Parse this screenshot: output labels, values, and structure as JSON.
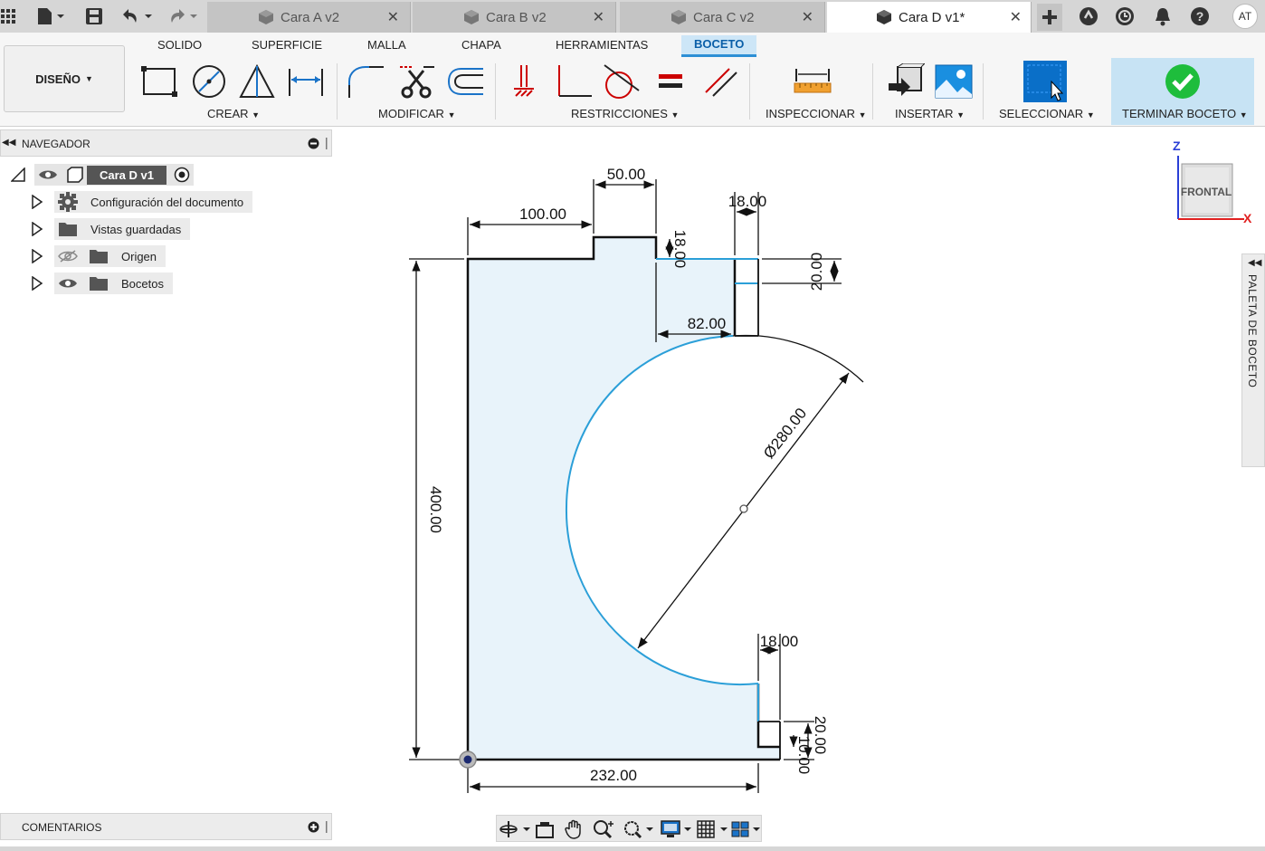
{
  "tabs": [
    {
      "label": "Cara A v2",
      "active": false
    },
    {
      "label": "Cara B v2",
      "active": false
    },
    {
      "label": "Cara C v2",
      "active": false
    },
    {
      "label": "Cara D v1*",
      "active": true
    }
  ],
  "user_initials": "AT",
  "workspace": "DISEÑO",
  "ribbon_tabs": [
    "SOLIDO",
    "SUPERFICIE",
    "MALLA",
    "CHAPA",
    "HERRAMIENTAS",
    "BOCETO"
  ],
  "active_ribbon_tab": "BOCETO",
  "groups": {
    "crear": "CREAR",
    "modificar": "MODIFICAR",
    "restricciones": "RESTRICCIONES",
    "inspeccionar": "INSPECCIONAR",
    "insertar": "INSERTAR",
    "seleccionar": "SELECCIONAR",
    "terminar": "TERMINAR BOCETO"
  },
  "navigator": {
    "title": "NAVEGADOR",
    "root": "Cara D v1",
    "items": [
      {
        "label": "Configuración del documento",
        "icon": "gear-icon"
      },
      {
        "label": "Vistas guardadas",
        "icon": "folder-icon"
      },
      {
        "label": "Origen",
        "icon": "folder-icon"
      },
      {
        "label": "Bocetos",
        "icon": "folder-icon"
      }
    ]
  },
  "comments_title": "COMENTARIOS",
  "viewcube_label": "FRONTAL",
  "axis_labels": {
    "z": "Z",
    "x": "X"
  },
  "palette_title": "PALETA DE BOCETO",
  "dimensions": {
    "top_step": "50.00",
    "top_left": "100.00",
    "notch_width_top": "18.00",
    "step_height": "18.00",
    "notch_height_top": "20.00",
    "inner_width": "82.00",
    "diameter": "Ø280.00",
    "height": "400.00",
    "notch_width_bottom": "18.00",
    "notch_height_bottom": "20.00",
    "bottom_step": "10.00",
    "bottom_width": "232.00"
  },
  "colors": {
    "accent": "#0696d7",
    "sketch_fill": "#e8f3fa",
    "arc": "#2b9fd8",
    "finish_check": "#1ebd3c"
  }
}
